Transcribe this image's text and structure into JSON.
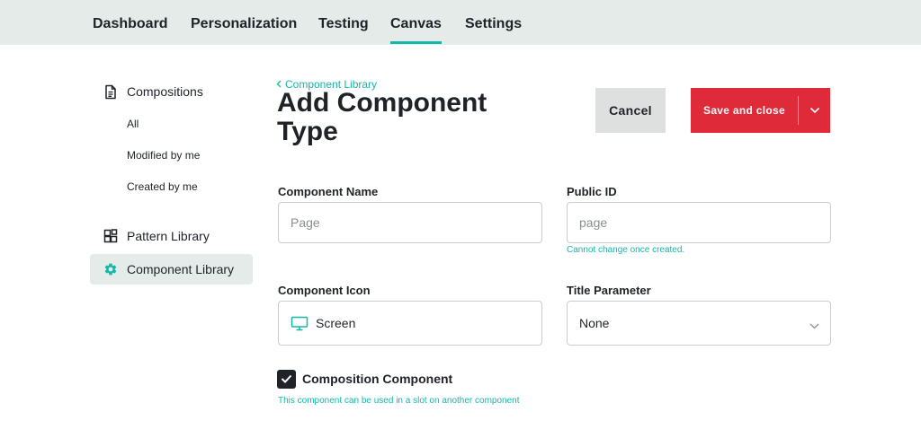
{
  "topnav": {
    "tabs": [
      {
        "label": "Dashboard"
      },
      {
        "label": "Personalization"
      },
      {
        "label": "Testing"
      },
      {
        "label": "Canvas",
        "active": true
      },
      {
        "label": "Settings"
      }
    ],
    "active_color": "#14b8a6"
  },
  "sidebar": {
    "compositions": {
      "label": "Compositions",
      "icon": "document-icon"
    },
    "sub_items": [
      {
        "label": "All"
      },
      {
        "label": "Modified by me"
      },
      {
        "label": "Created by me"
      }
    ],
    "pattern_library": {
      "label": "Pattern Library",
      "icon": "blocks-icon"
    },
    "component_library": {
      "label": "Component Library",
      "icon": "gear-icon",
      "active": true
    }
  },
  "breadcrumb": {
    "label": "Component Library"
  },
  "page": {
    "title": "Add Component Type"
  },
  "actions": {
    "cancel_label": "Cancel",
    "save_label": "Save and close",
    "save_color": "#df2a3a"
  },
  "form": {
    "component_name": {
      "label": "Component Name",
      "placeholder": "Page"
    },
    "public_id": {
      "label": "Public ID",
      "placeholder": "page",
      "hint": "Cannot change once created."
    },
    "component_icon": {
      "label": "Component Icon",
      "value": "Screen",
      "icon": "monitor-icon"
    },
    "title_parameter": {
      "label": "Title Parameter",
      "value": "None"
    },
    "composition_component": {
      "label": "Composition Component",
      "checked": true,
      "hint": "This component can be used in a slot on another component"
    }
  }
}
